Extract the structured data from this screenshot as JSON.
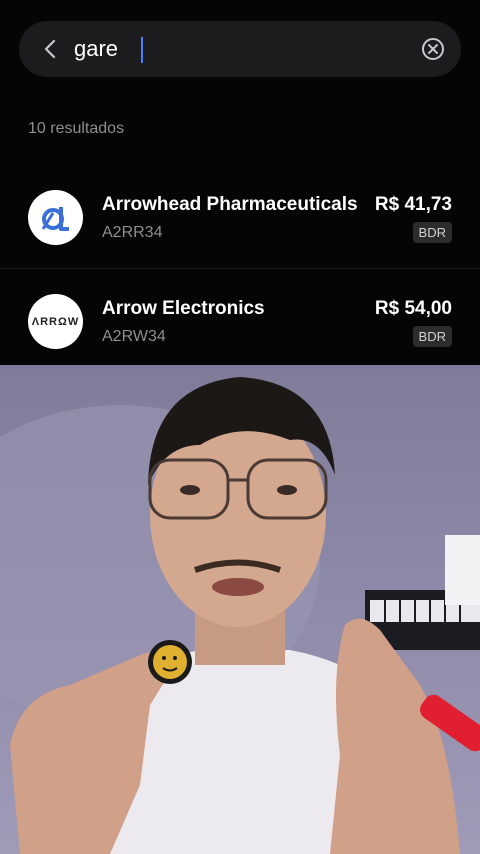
{
  "search": {
    "query": "gare",
    "back_icon": "chevron-left-icon",
    "clear_icon": "clear-circle-icon"
  },
  "results_count": "10 resultados",
  "results": [
    {
      "name": "Arrowhead Pharmaceuticals",
      "ticker": "A2RR34",
      "price": "R$ 41,73",
      "badge": "BDR",
      "logo_icon": "arrowhead-logo-icon"
    },
    {
      "name": "Arrow Electronics",
      "ticker": "A2RW34",
      "price": "R$ 54,00",
      "badge": "BDR",
      "logo_icon": "arrow-electronics-logo-icon"
    }
  ],
  "logo_text": {
    "arrow_electronics": "ΛRRΩW"
  },
  "colors": {
    "background": "#050505",
    "search_bg": "#1c1c1e",
    "badge_bg": "#2c2c2e",
    "accent": "#3a6fd8"
  }
}
